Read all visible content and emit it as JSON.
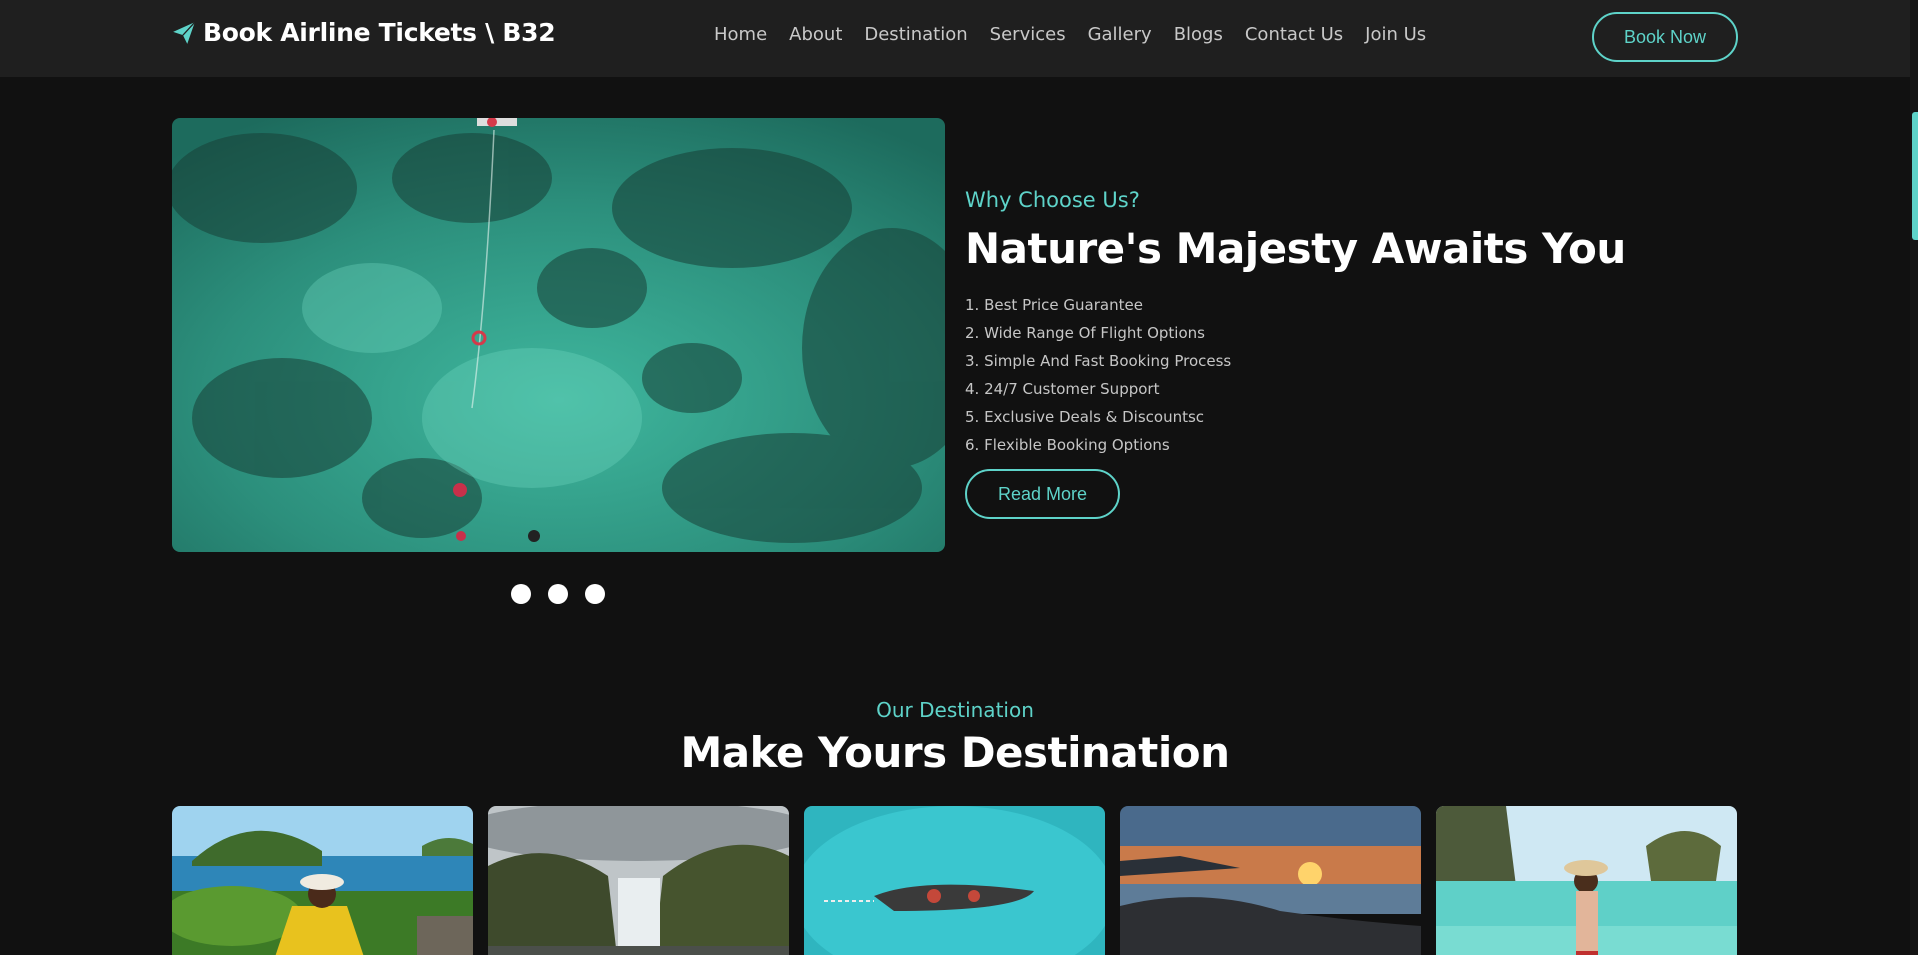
{
  "brand": {
    "name": "Book Airline Tickets \\ B32",
    "icon": "paper-plane-icon"
  },
  "nav": {
    "items": [
      "Home",
      "About",
      "Destination",
      "Services",
      "Gallery",
      "Blogs",
      "Contact Us",
      "Join Us"
    ],
    "cta": "Book Now"
  },
  "hero": {
    "eyebrow": "Why Choose Us?",
    "title": "Nature's Majesty Awaits You",
    "features": [
      "1. Best Price Guarantee",
      "2. Wide Range Of Flight Options",
      "3. Simple And Fast Booking Process",
      "4. 24/7 Customer Support",
      "5. Exclusive Deals & Discountsc",
      "6. Flexible Booking Options"
    ],
    "button": "Read More",
    "slide_count": 3
  },
  "destination": {
    "eyebrow": "Our Destination",
    "title": "Make Yours Destination"
  },
  "colors": {
    "accent": "#5ed3c9",
    "background": "#111111",
    "header": "#1f1f1f"
  }
}
